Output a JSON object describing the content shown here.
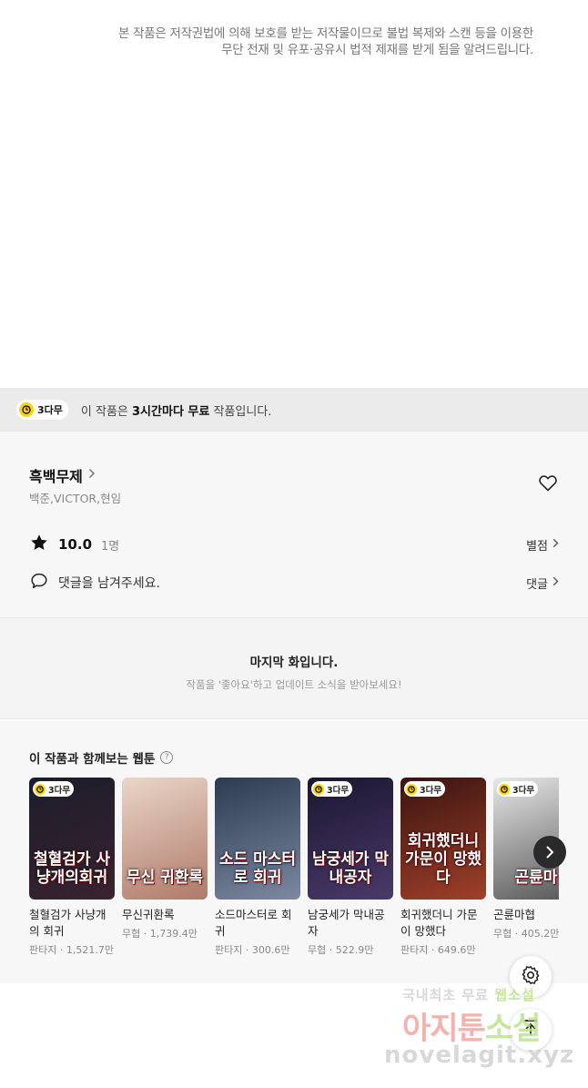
{
  "copyright": {
    "line1": "본 작품은 저작권법에 의해 보호를 받는 저작물이므로 불법 복제와 스캔 등을 이용한",
    "line2": "무단 전재 및 유포·공유시 법적 제재를 받게 됨을 알려드립니다."
  },
  "free_bar": {
    "badge": "3다무",
    "prefix": "이 작품은 ",
    "bold": "3시간마다 무료",
    "suffix": " 작품입니다."
  },
  "work": {
    "title": "흑백무제",
    "authors": "백준,VICTOR,현임",
    "rating": "10.0",
    "rating_count": "1명",
    "rate_link": "별점",
    "comment_prompt": "댓글을 남겨주세요.",
    "comment_link": "댓글"
  },
  "last_episode": {
    "title": "마지막 화입니다.",
    "subtitle": "작품을 '좋아요'하고 업데이트 소식을 받아보세요!"
  },
  "recommend": {
    "title": "이 작품과 함께보는 웹툰",
    "help": "?",
    "items": [
      {
        "name": "철혈검가 사냥개의 회귀",
        "genre": "판타지",
        "views": "1,521.7만",
        "badge": "3다무",
        "cover_text": "철혈검가 사냥개의회귀",
        "colors": [
          "#1b1d2a",
          "#3a2230"
        ]
      },
      {
        "name": "무신귀환록",
        "genre": "무협",
        "views": "1,739.4만",
        "badge": "",
        "cover_text": "무신 귀환록",
        "colors": [
          "#e9d6c8",
          "#b07a6a"
        ]
      },
      {
        "name": "소드마스터로 회귀",
        "genre": "판타지",
        "views": "300.6만",
        "badge": "",
        "cover_text": "소드 마스터로 회귀",
        "colors": [
          "#2c3a52",
          "#7c8aa0"
        ]
      },
      {
        "name": "남궁세가 막내공자",
        "genre": "무협",
        "views": "522.9만",
        "badge": "3다무",
        "cover_text": "남궁세가 막내공자",
        "colors": [
          "#1a1630",
          "#4a3a6a"
        ]
      },
      {
        "name": "회귀했더니 가문이 망했다",
        "genre": "판타지",
        "views": "649.6만",
        "badge": "3다무",
        "cover_text": "회귀했더니 가문이 망했다",
        "colors": [
          "#3a1410",
          "#a0402a"
        ]
      },
      {
        "name": "곤륜마협",
        "genre": "무협",
        "views": "405.2만",
        "badge": "3다무",
        "cover_text": "곤륜마",
        "colors": [
          "#e8e8e8",
          "#555555"
        ]
      }
    ]
  },
  "watermark": {
    "line1a": "국내최초 무료 ",
    "line1b": "웹소설",
    "line2a": "아지툰",
    "line2b": "소설",
    "line3": "novelagit.xyz"
  }
}
